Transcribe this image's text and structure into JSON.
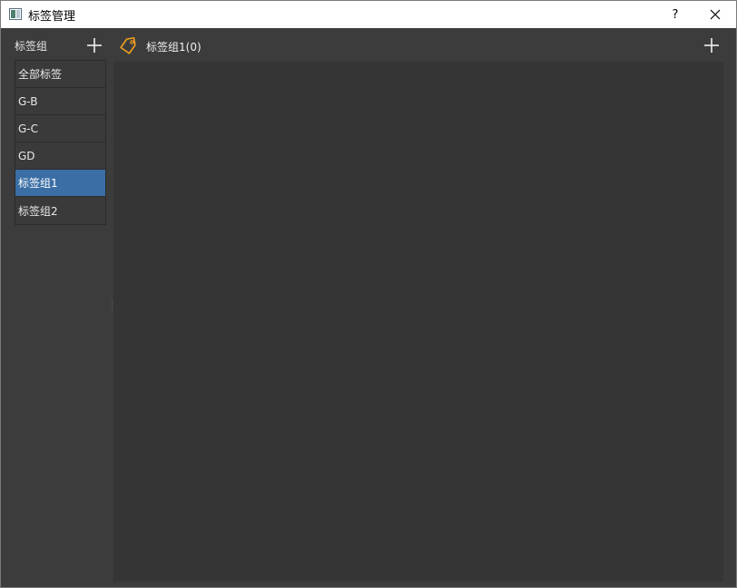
{
  "window": {
    "title": "标签管理",
    "help_label": "?",
    "close_label": "close"
  },
  "sidebar": {
    "title": "标签组",
    "add_label": "+",
    "items": [
      {
        "label": "全部标签",
        "selected": false
      },
      {
        "label": "G-B",
        "selected": false
      },
      {
        "label": "G-C",
        "selected": false
      },
      {
        "label": "GD",
        "selected": false
      },
      {
        "label": "标签组1",
        "selected": true
      },
      {
        "label": "标签组2",
        "selected": false
      }
    ]
  },
  "main": {
    "group_title": "标签组1(0)",
    "tag_icon": "tag-icon",
    "add_label": "+"
  },
  "colors": {
    "background": "#3c3c3c",
    "content": "#353535",
    "selected": "#3a6ea5",
    "tag_icon": "#f0a020"
  }
}
